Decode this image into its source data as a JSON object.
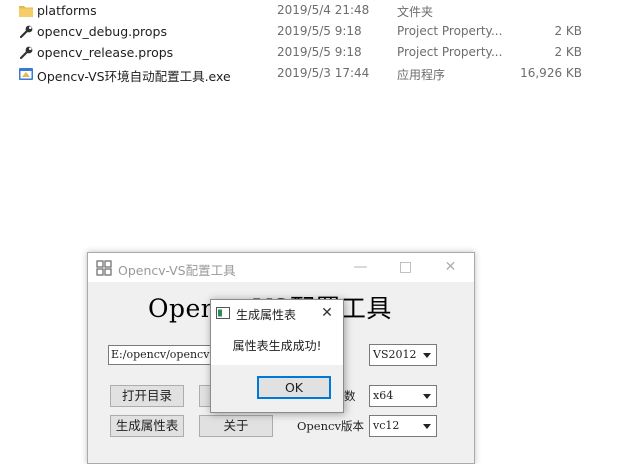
{
  "files": [
    {
      "icon": "folder-icon",
      "name": "platforms",
      "date": "2019/5/4 21:48",
      "type": "文件夹",
      "size": ""
    },
    {
      "icon": "props-file-icon",
      "name": "opencv_debug.props",
      "date": "2019/5/5 9:18",
      "type": "Project Property...",
      "size": "2 KB"
    },
    {
      "icon": "props-file-icon",
      "name": "opencv_release.props",
      "date": "2019/5/5 9:18",
      "type": "Project Property...",
      "size": "2 KB"
    },
    {
      "icon": "exe-file-icon",
      "name": "Opencv-VS环境自动配置工具.exe",
      "date": "2019/5/3 17:44",
      "type": "应用程序",
      "size": "16,926 KB"
    }
  ],
  "app": {
    "title": "Opencv-VS配置工具",
    "heading": "Opencv-VS配置工具",
    "path_value": "E:/opencv/opencv",
    "buttons": {
      "open_dir": "打开目录",
      "generate": "生成属性表",
      "about": "关于"
    },
    "labels": {
      "platform_partial": "数",
      "opencv_version": "Opencv版本"
    },
    "combos": {
      "vs_version": "VS2012",
      "platform": "x64",
      "vc_version": "vc12"
    }
  },
  "dialog": {
    "title": "生成属性表",
    "message": "属性表生成成功!",
    "ok_label": "OK"
  },
  "colors": {
    "folder": "#e8b84a",
    "accent": "#0078d7"
  }
}
